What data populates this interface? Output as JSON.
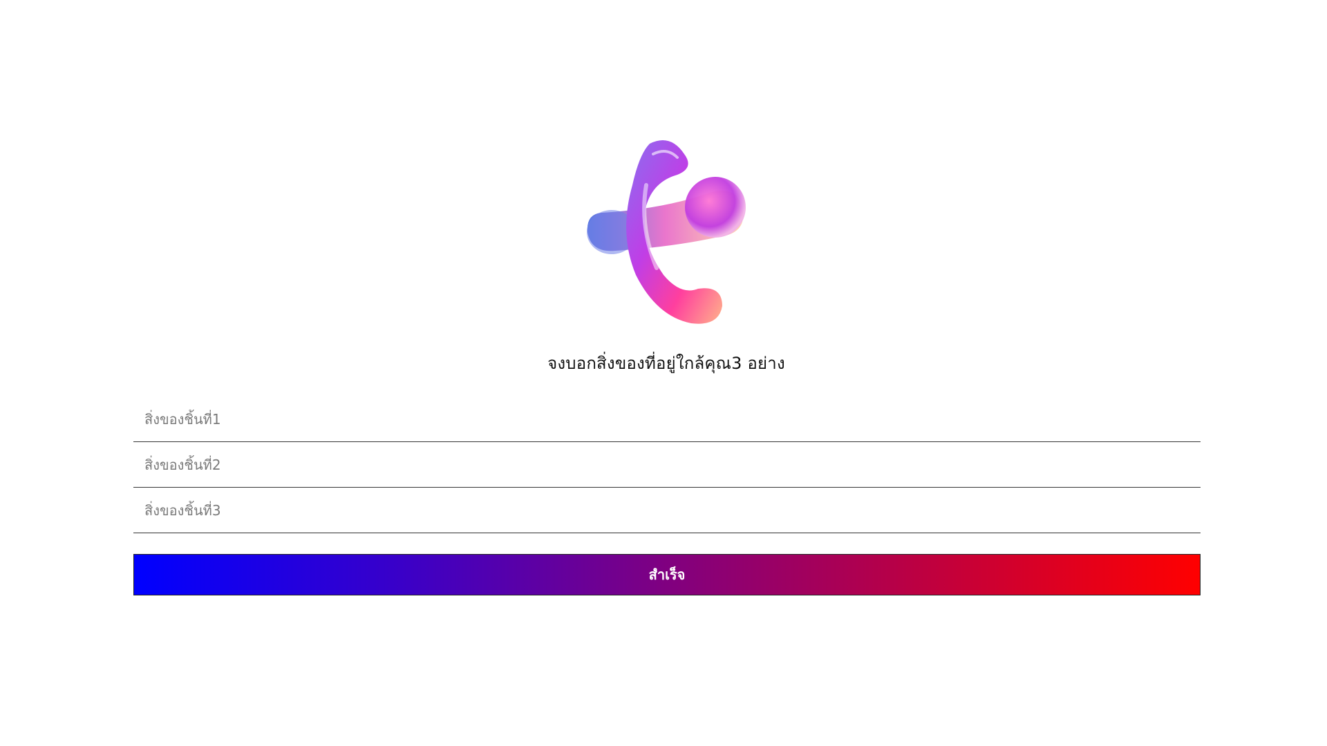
{
  "logo": {
    "icon": "glossy-3d-gradient-loop-logo",
    "colors": [
      "#6a4bd8",
      "#c23be0",
      "#ff3fa8",
      "#ff6a4a",
      "#f9c7a0"
    ]
  },
  "heading": "จงบอกสิ่งของที่อยู่ใกล้คุณ3 อย่าง",
  "fields": [
    {
      "placeholder": "สิ่งของชิ้นที่1",
      "value": ""
    },
    {
      "placeholder": "สิ่งของชิ้นที่2",
      "value": ""
    },
    {
      "placeholder": "สิ่งของชิ้นที่3",
      "value": ""
    }
  ],
  "submit": {
    "label": "สำเร็จ",
    "gradient_start": "#0000ff",
    "gradient_end": "#ff0000"
  }
}
